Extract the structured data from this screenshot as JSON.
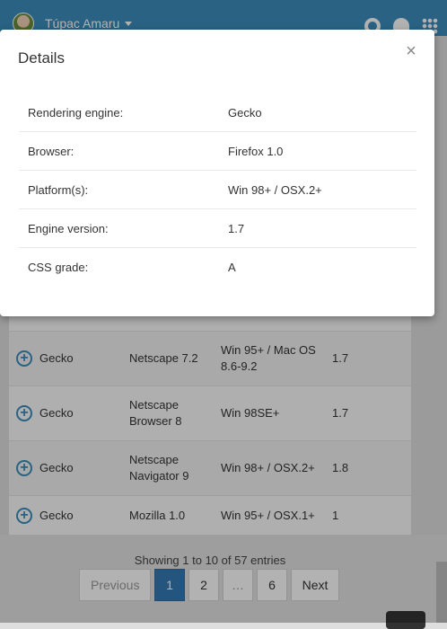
{
  "header": {
    "user_name": "Túpac Amaru",
    "icons": [
      "gear-icon",
      "bell-icon",
      "apps-grid-icon"
    ]
  },
  "table": {
    "rows": [
      {
        "engine": "Gecko",
        "browser": "Netscape 7.2",
        "platform": "Win 95+ / Mac OS 8.6-9.2",
        "version": "1.7"
      },
      {
        "engine": "Gecko",
        "browser": "Netscape Browser 8",
        "platform": "Win 98SE+",
        "version": "1.7"
      },
      {
        "engine": "Gecko",
        "browser": "Netscape Navigator 9",
        "platform": "Win 98+ / OSX.2+",
        "version": "1.8"
      },
      {
        "engine": "Gecko",
        "browser": "Mozilla 1.0",
        "platform": "Win 95+ / OSX.1+",
        "version": "1"
      }
    ],
    "showing": "Showing 1 to 10 of 57 entries"
  },
  "pagination": {
    "previous": "Previous",
    "pages": [
      "1",
      "2",
      "…",
      "6"
    ],
    "next": "Next",
    "active_page": "1"
  },
  "modal": {
    "title": "Details",
    "close": "×",
    "rows": [
      {
        "label": "Rendering engine:",
        "value": "Gecko"
      },
      {
        "label": "Browser:",
        "value": "Firefox 1.0"
      },
      {
        "label": "Platform(s):",
        "value": "Win 98+ / OSX.2+"
      },
      {
        "label": "Engine version:",
        "value": "1.7"
      },
      {
        "label": "CSS grade:",
        "value": "A"
      }
    ]
  },
  "colors": {
    "header": "#3c8dbc",
    "active_page": "#337ab7"
  }
}
